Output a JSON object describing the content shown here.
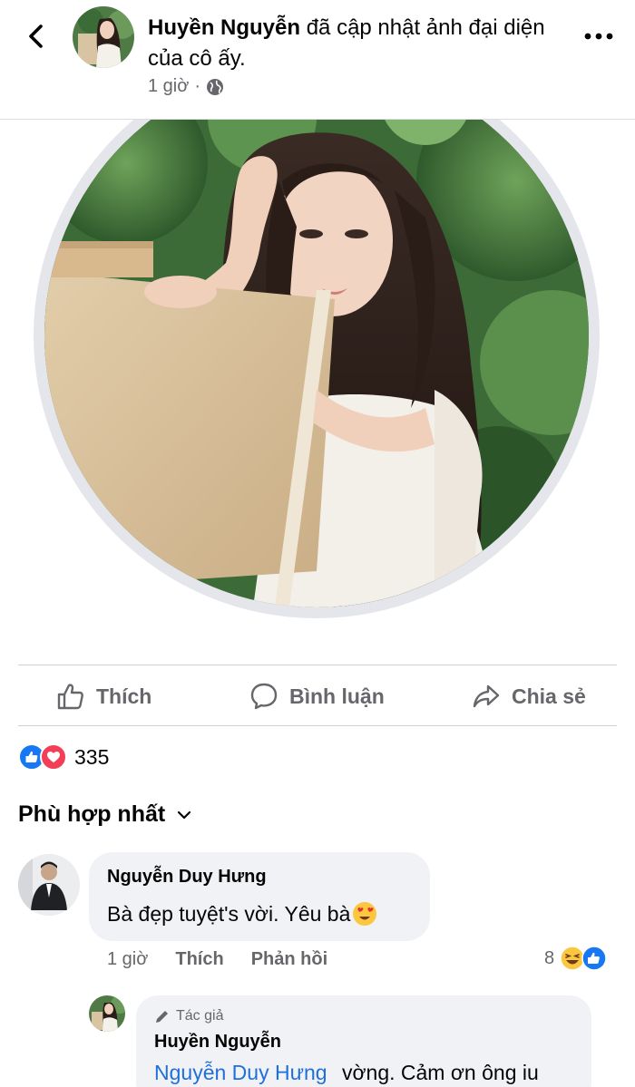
{
  "post": {
    "author": "Huyền Nguyễn",
    "action_text": "đã cập nhật ảnh đại diện của cô ấy.",
    "time": "1 giờ",
    "separator": "·",
    "privacy_icon": "globe-icon"
  },
  "actions": {
    "like": "Thích",
    "comment": "Bình luận",
    "share": "Chia sẻ"
  },
  "reactions": {
    "types": [
      "like-icon",
      "love-icon"
    ],
    "count": "335"
  },
  "sort": {
    "label": "Phù hợp nhất"
  },
  "comment": {
    "author": "Nguyễn Duy Hưng",
    "text": "Bà đẹp tuyệt's vời. Yêu bà",
    "emoji_icon": "heart-eyes-emoji-icon",
    "time": "1 giờ",
    "like": "Thích",
    "reply": "Phản hồi",
    "reaction_count": "8",
    "reaction_types": [
      "laughing-icon",
      "like-icon"
    ]
  },
  "reply": {
    "badge": "Tác giả",
    "author": "Huyền Nguyễn",
    "mention": "Nguyễn Duy Hưng",
    "text": "vờng. Cảm ơn ông iu"
  },
  "colors": {
    "facebook_blue": "#1877f2",
    "love_red": "#f33e58",
    "secondary_text": "#65676b",
    "bubble_bg": "#f0f2f5",
    "mention_blue": "#216fdb"
  }
}
